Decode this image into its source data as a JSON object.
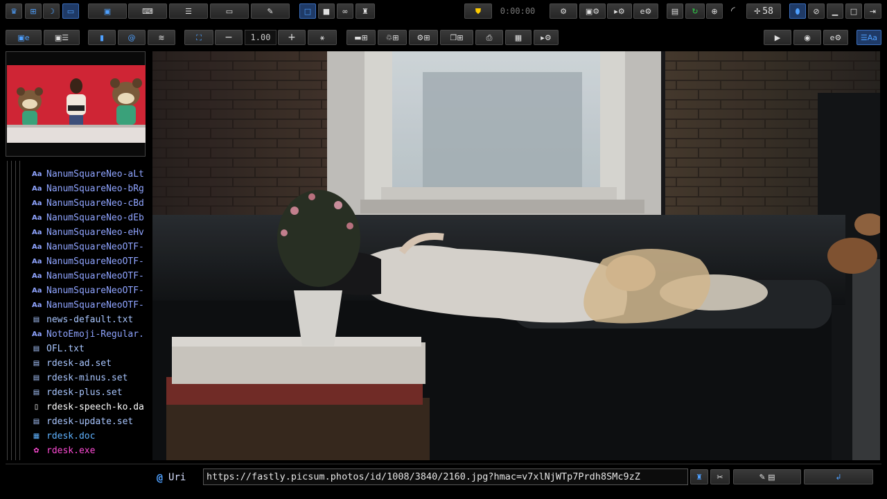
{
  "toolbar_top": {
    "timer": "0:00:00",
    "counter": "58"
  },
  "toolbar_second": {
    "zoom": "1.00",
    "zoom_minus": "−",
    "zoom_plus": "+"
  },
  "file_list": [
    {
      "name": "NanumSquareNeo-aLt",
      "type": "font"
    },
    {
      "name": "NanumSquareNeo-bRg",
      "type": "font"
    },
    {
      "name": "NanumSquareNeo-cBd",
      "type": "font"
    },
    {
      "name": "NanumSquareNeo-dEb",
      "type": "font"
    },
    {
      "name": "NanumSquareNeo-eHv",
      "type": "font"
    },
    {
      "name": "NanumSquareNeoOTF-",
      "type": "font"
    },
    {
      "name": "NanumSquareNeoOTF-",
      "type": "font"
    },
    {
      "name": "NanumSquareNeoOTF-",
      "type": "font"
    },
    {
      "name": "NanumSquareNeoOTF-",
      "type": "font"
    },
    {
      "name": "NanumSquareNeoOTF-",
      "type": "font"
    },
    {
      "name": "news-default.txt",
      "type": "text"
    },
    {
      "name": "NotoEmoji-Regular.",
      "type": "font"
    },
    {
      "name": "OFL.txt",
      "type": "text"
    },
    {
      "name": "rdesk-ad.set",
      "type": "text"
    },
    {
      "name": "rdesk-minus.set",
      "type": "text"
    },
    {
      "name": "rdesk-plus.set",
      "type": "text"
    },
    {
      "name": "rdesk-speech-ko.da",
      "type": "plain"
    },
    {
      "name": "rdesk-update.set",
      "type": "text"
    },
    {
      "name": "rdesk.doc",
      "type": "doc"
    },
    {
      "name": "rdesk.exe",
      "type": "exe"
    }
  ],
  "file_icons": {
    "font": "Aa",
    "text": "▤",
    "plain": "▯",
    "doc": "▦",
    "exe": "✿"
  },
  "bottom_bar": {
    "uri_label": "Uri",
    "uri_value": "https://fastly.picsum.photos/id/1008/3840/2160.jpg?hmac=v7xlNjWTp7Prdh8SMc9zZ",
    "enter_symbol": "↲"
  },
  "colors": {
    "accent": "#4ea0ff",
    "font_file": "#8fa4ff",
    "exe_file": "#ff4bd6"
  }
}
